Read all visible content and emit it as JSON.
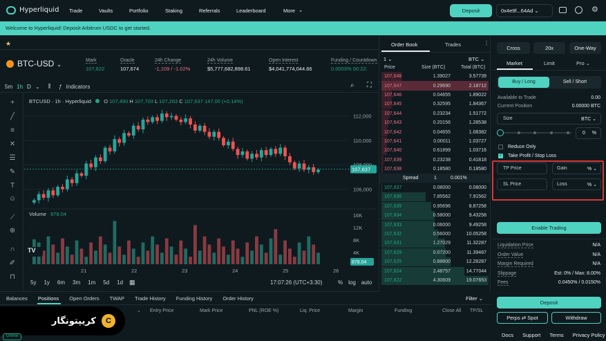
{
  "nav": {
    "logo": "Hyperliquid",
    "links": [
      "Trade",
      "Vaults",
      "Portfolio",
      "Staking",
      "Referrals",
      "Leaderboard",
      "More"
    ],
    "deposit": "Deposit",
    "wallet": "0x4e9f...64Ad"
  },
  "banner": "Welcome to Hyperliquid! Deposit Arbitrum USDC to get started.",
  "market": {
    "pair": "BTC-USD",
    "stats": [
      {
        "label": "Mark",
        "value": "107,622",
        "color": "#1fa67d"
      },
      {
        "label": "Oracle",
        "value": "107,674",
        "color": "#e8eded"
      },
      {
        "label": "24h Change",
        "value": "-1,109 / -1.02%",
        "color": "#ed7088"
      },
      {
        "label": "24h Volume",
        "value": "$5,777,682,898.61",
        "color": "#e8eded"
      },
      {
        "label": "Open Interest",
        "value": "$4,041,774,044.66",
        "color": "#e8eded"
      },
      {
        "label": "Funding / Countdown",
        "value": "0.0003%  00:22:",
        "color": "#1fa67d"
      }
    ]
  },
  "chart_toolbar": {
    "timeframes": [
      "5m",
      "1h",
      "D"
    ],
    "indicators": "Indicators"
  },
  "chart_legend": {
    "symbol": "BTCUSD · 1h · Hyperliquid",
    "o": "107,490",
    "h": "107,703",
    "l": "107,263",
    "c": "107,637",
    "chg": "147.00 (+0.14%)"
  },
  "chart_data": {
    "type": "candlestick",
    "y_ticks": [
      "112,000",
      "110,000",
      "108,000",
      "106,000"
    ],
    "last_price": "107,637",
    "volume_label": "Volume",
    "volume_value": "878.04",
    "volume_ticks": [
      "16K",
      "12K",
      "8K",
      "4K"
    ],
    "volume_last": "878.04",
    "x_ticks": [
      "21",
      "22",
      "23",
      "24",
      "25",
      "26"
    ],
    "ylim": [
      104500,
      113000
    ],
    "closes": [
      105100,
      105600,
      105300,
      105900,
      105500,
      106200,
      106000,
      106800,
      106500,
      107300,
      107100,
      108100,
      107800,
      108600,
      108300,
      109400,
      109100,
      110100,
      109800,
      110600,
      110400,
      111200,
      110900,
      111700,
      111500,
      111900,
      111600,
      112200,
      111900,
      112000,
      111700,
      111500,
      111800,
      111300,
      110800,
      111200,
      110700,
      110300,
      110700,
      110200,
      109600,
      109900,
      109300,
      108800,
      109100,
      108500,
      108900,
      108600,
      109200,
      108800,
      109300,
      108900,
      109400,
      108700,
      108200,
      107700,
      108100,
      107600,
      107800,
      107400,
      107600
    ]
  },
  "chart_bottom": {
    "ranges": [
      "5y",
      "1y",
      "6m",
      "3m",
      "1m",
      "5d",
      "1d"
    ],
    "time": "17:07:26 (UTC+3:30)",
    "options": [
      "%",
      "log",
      "auto"
    ]
  },
  "orderbook": {
    "tabs": [
      "Order Book",
      "Trades"
    ],
    "tick": "1",
    "asset": "BTC",
    "headers": [
      "Price",
      "Size (BTC)",
      "Total (BTC)"
    ],
    "asks": [
      [
        "107,648",
        "1.39027",
        "3.57739"
      ],
      [
        "107,647",
        "0.29690",
        "2.18712"
      ],
      [
        "107,646",
        "0.04655",
        "1.89022"
      ],
      [
        "107,645",
        "0.32595",
        "1.84367"
      ],
      [
        "107,644",
        "0.23234",
        "1.51772"
      ],
      [
        "107,643",
        "0.20156",
        "1.28538"
      ],
      [
        "107,642",
        "0.04655",
        "1.08382"
      ],
      [
        "107,641",
        "0.00011",
        "1.03727"
      ],
      [
        "107,640",
        "0.61899",
        "1.03716"
      ],
      [
        "107,639",
        "0.23238",
        "0.41818"
      ],
      [
        "107,638",
        "0.18580",
        "0.18580"
      ]
    ],
    "spread": {
      "label": "Spread",
      "value": "1",
      "pct": "0.001%"
    },
    "bids": [
      [
        "107,637",
        "0.08000",
        "0.08000"
      ],
      [
        "107,636",
        "7.85562",
        "7.91562"
      ],
      [
        "107,635",
        "0.95696",
        "8.87258"
      ],
      [
        "107,634",
        "0.58000",
        "9.43258"
      ],
      [
        "107,633",
        "0.06000",
        "9.49258"
      ],
      [
        "107,632",
        "0.56000",
        "10.05258"
      ],
      [
        "107,631",
        "1.27029",
        "11.32287"
      ],
      [
        "107,629",
        "0.07200",
        "11.39487"
      ],
      [
        "107,625",
        "0.88800",
        "12.28287"
      ],
      [
        "107,624",
        "2.48757",
        "14.77044"
      ],
      [
        "107,622",
        "4.30609",
        "19.07653"
      ]
    ]
  },
  "order_panel": {
    "margin": "Cross",
    "leverage": "20x",
    "mode": "One-Way",
    "types": [
      "Market",
      "Limit",
      "Pro"
    ],
    "sides": [
      "Buy / Long",
      "Sell / Short"
    ],
    "available_label": "Available to Trade",
    "available_value": "0.00",
    "position_label": "Current Position",
    "position_value": "0.00000 BTC",
    "size_label": "Size",
    "size_asset": "BTC",
    "size_pct": "0",
    "pct": "%",
    "reduce_only": "Reduce Only",
    "tpsl": "Take Profit / Stop Loss",
    "tp_price": "TP Price",
    "gain": "Gain",
    "sl_price": "SL Price",
    "loss": "Loss",
    "enable": "Enable Trading",
    "info": [
      {
        "label": "Liquidation Price",
        "value": "N/A"
      },
      {
        "label": "Order Value",
        "value": "N/A"
      },
      {
        "label": "Margin Required",
        "value": "N/A"
      },
      {
        "label": "Slippage",
        "value": "Est: 0% / Max: 8.00%"
      },
      {
        "label": "Fees",
        "value": "0.0450% / 0.0150%"
      }
    ],
    "deposit": "Deposit",
    "perps_spot": "Perps ⇄ Spot",
    "withdraw": "Withdraw"
  },
  "bottom_tabs": [
    "Balances",
    "Positions",
    "Open Orders",
    "TWAP",
    "Trade History",
    "Funding History",
    "Order History"
  ],
  "filter": "Filter",
  "positions_headers": [
    "Entry Price",
    "Mark Price",
    "PNL (ROE %)",
    "Liq. Price",
    "Margin",
    "Funding",
    "Close All",
    "TP/SL"
  ],
  "footer": [
    "Docs",
    "Support",
    "Terms",
    "Privacy Policy"
  ],
  "watermark": "کریپتونگار",
  "status": "Online"
}
